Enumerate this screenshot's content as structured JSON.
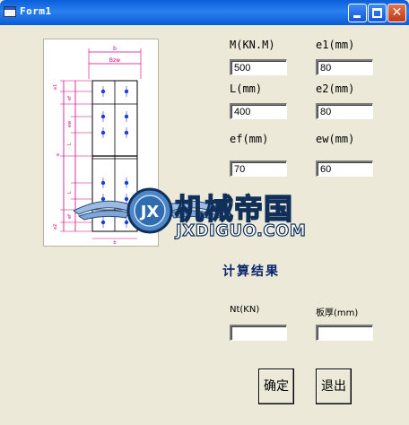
{
  "window": {
    "title": "Form1",
    "controls": {
      "minimize": "_",
      "maximize": "□",
      "close": "✕"
    }
  },
  "drawing": {
    "dims": [
      "b",
      "Bzw",
      "e1",
      "e2",
      "ef",
      "ew",
      "L",
      "a",
      "b"
    ]
  },
  "inputs": {
    "M": {
      "label": "M(KN.M)",
      "value": "500"
    },
    "e1": {
      "label": "e1(mm)",
      "value": "80"
    },
    "L": {
      "label": "L(mm)",
      "value": "400"
    },
    "e2": {
      "label": "e2(mm)",
      "value": "80"
    },
    "ef": {
      "label": "ef(mm)",
      "value": "70"
    },
    "ew": {
      "label": "ew(mm)",
      "value": "60"
    }
  },
  "results": {
    "title": "计算结果",
    "nt": {
      "label": "Nt(KN)",
      "value": ""
    },
    "thickness": {
      "label": "板厚(mm)",
      "value": ""
    }
  },
  "buttons": {
    "ok": "确定",
    "exit": "退出"
  },
  "watermark": {
    "badge": "JX",
    "cn": "机械帝国",
    "en": "JXDIGUO.COM"
  },
  "colors": {
    "titlebar": "#0a5ed9",
    "form_bg": "#ece9d8",
    "result_title": "#0a246a",
    "drawing_line": "#d4007f",
    "drawing_blue": "#1f3fd0"
  }
}
